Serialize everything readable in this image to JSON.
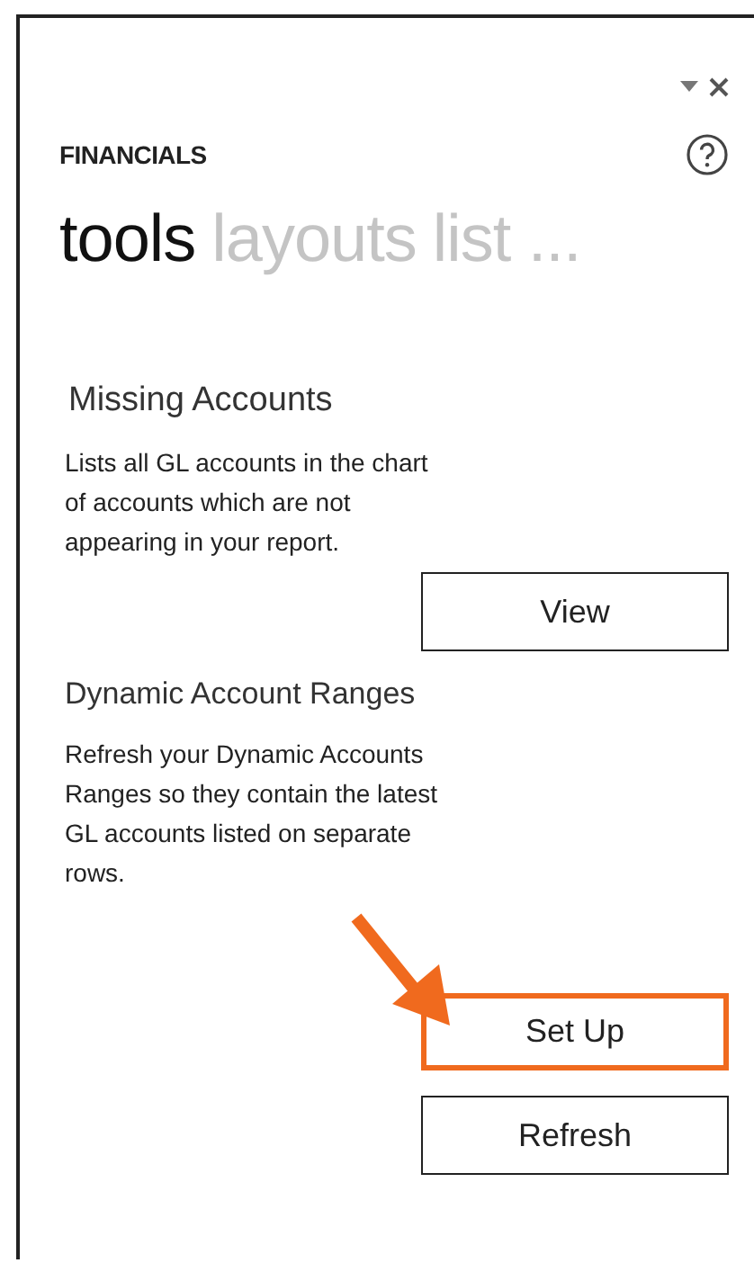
{
  "pane": {
    "title": "FINANCIALS"
  },
  "tabs": [
    {
      "label": "tools",
      "selected": true
    },
    {
      "label": "layouts",
      "selected": false
    },
    {
      "label": "list ...",
      "selected": false
    }
  ],
  "sections": [
    {
      "title": "Missing Accounts",
      "kind": "primary",
      "description": "Lists all GL accounts in the chart of accounts which are not appearing in your report.",
      "buttons": [
        {
          "label": "View",
          "highlighted": false
        }
      ]
    },
    {
      "title": "Dynamic Account Ranges",
      "kind": "secondary",
      "description": "Refresh your Dynamic Accounts Ranges so they contain the latest GL accounts listed on separate rows.",
      "buttons": [
        {
          "label": "Set Up",
          "highlighted": true
        },
        {
          "label": "Refresh",
          "highlighted": false
        }
      ]
    }
  ]
}
